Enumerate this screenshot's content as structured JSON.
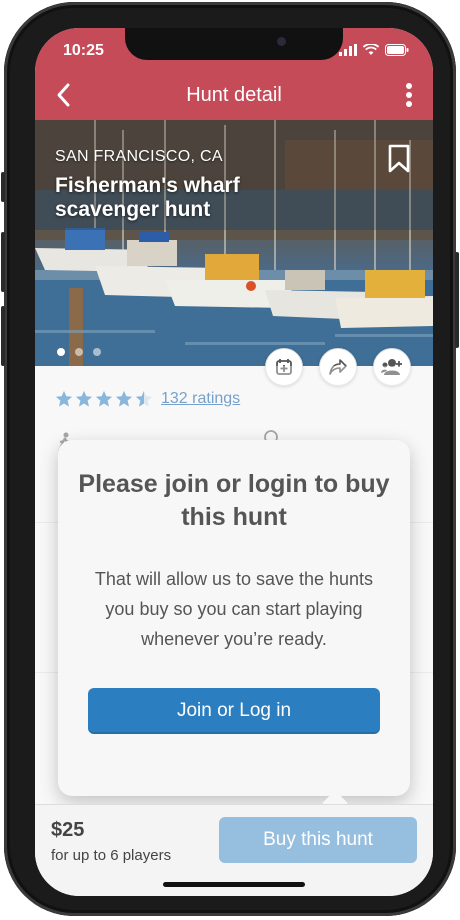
{
  "status_bar": {
    "time": "10:25"
  },
  "header": {
    "title": "Hunt detail"
  },
  "hero": {
    "city": "SAN FRANCISCO, CA",
    "title": "Fisherman's wharf scavenger hunt",
    "photo_dot_count": 3,
    "active_photo_dot": 1
  },
  "rating": {
    "stars": 4.5,
    "max_stars": 5,
    "link_text": "132 ratings",
    "star_color": "#4a90c8"
  },
  "modal": {
    "title": "Please join or login to buy this hunt",
    "body": "That will allow us to save the hunts you buy so you can start playing whenever you’re ready.",
    "button_label": "Join or Log in"
  },
  "footer": {
    "price": "$25",
    "price_note": "for up to 6 players",
    "buy_label": "Buy this hunt"
  },
  "colors": {
    "header_bg": "#c64b58",
    "primary_button": "#2b7fc0",
    "disabled_button": "#96bfdf",
    "link": "#2f6fae"
  },
  "icons": {
    "back": "chevron-left-icon",
    "more": "vertical-dots-icon",
    "bookmark": "bookmark-icon",
    "calendar": "calendar-add-icon",
    "share": "share-icon",
    "invite": "add-user-icon"
  }
}
